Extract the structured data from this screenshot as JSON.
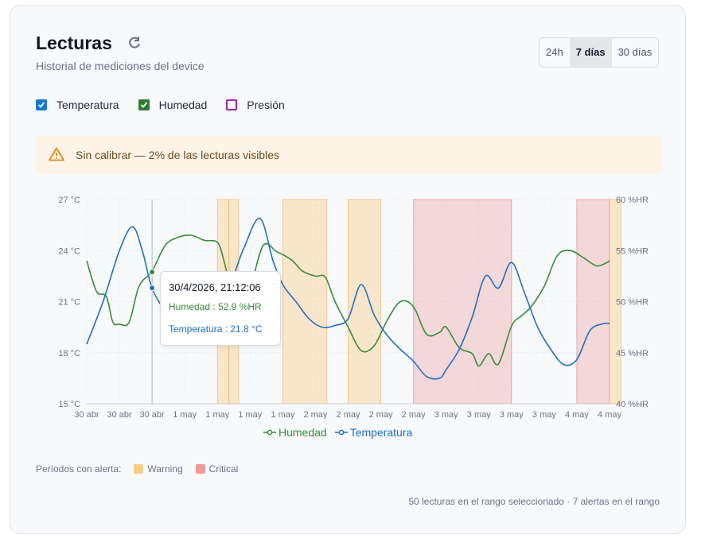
{
  "header": {
    "title": "Lecturas",
    "subtitle": "Historial de mediciones del device",
    "range_options": [
      "24h",
      "7 días",
      "30 días"
    ],
    "range_selected": "7 días"
  },
  "toggles": [
    {
      "label": "Temperatura",
      "checked": true,
      "color": "#1976d2"
    },
    {
      "label": "Humedad",
      "checked": true,
      "color": "#2e7d32"
    },
    {
      "label": "Presión",
      "checked": false,
      "color": "#9c27b0"
    }
  ],
  "banner": {
    "icon": "warning-triangle-icon",
    "text": "Sin calibrar — 2% de las lecturas visibles"
  },
  "colors": {
    "temperature": "#1e6fc4",
    "humidity": "#3a8a3a",
    "warning": "#f7cd86",
    "critical": "#ef9a9a"
  },
  "chart_data": {
    "type": "line",
    "x_ticks": [
      "30 abr",
      "30 abr",
      "30 abr",
      "1 may",
      "1 may",
      "1 may",
      "1 may",
      "2 may",
      "2 may",
      "2 may",
      "2 may",
      "3 may",
      "3 may",
      "3 may",
      "3 may",
      "4 may",
      "4 may"
    ],
    "y_left": {
      "label_unit": "°C",
      "ticks": [
        "27 °C",
        "24 °C",
        "21 °C",
        "18 °C",
        "15 °C"
      ],
      "range": [
        15,
        27
      ]
    },
    "y_right": {
      "label_unit": "%HR",
      "ticks": [
        "60 %HR",
        "55 %HR",
        "50 %HR",
        "45 %HR",
        "40 %HR"
      ],
      "range": [
        40,
        60
      ]
    },
    "series": [
      {
        "name": "Humedad",
        "axis": "right",
        "x": [
          0,
          0.3,
          0.6,
          0.8,
          1,
          1.3,
          1.6,
          2,
          2.4,
          2.8,
          3.2,
          3.6,
          4,
          4.2,
          4.4,
          4.6,
          4.8,
          5,
          5.4,
          5.8,
          6,
          6.3,
          6.6,
          7,
          7.3,
          7.6,
          8,
          8.4,
          8.8,
          9.2,
          9.6,
          10,
          10.4,
          10.8,
          11,
          11.4,
          11.8,
          12,
          12.3,
          12.6,
          13,
          13.3,
          13.6,
          14,
          14.4,
          14.8,
          15.2,
          15.6,
          15.9,
          16
        ],
        "values": [
          54,
          51,
          50.5,
          48,
          47.8,
          48,
          51.5,
          53,
          55.5,
          56.3,
          56.5,
          56,
          55.8,
          54,
          51.5,
          51.5,
          51,
          51.3,
          55.5,
          54.9,
          54.6,
          54,
          53,
          52.5,
          52.4,
          50,
          47.5,
          45.2,
          45.7,
          48.2,
          50,
          49.5,
          46.8,
          47,
          47.5,
          45.5,
          44.9,
          43.7,
          44.9,
          43.9,
          47.6,
          48.6,
          49.5,
          51.5,
          54.5,
          55,
          54.3,
          53.5,
          53.8,
          54
        ]
      },
      {
        "name": "Temperatura",
        "axis": "left",
        "x": [
          0,
          0.5,
          1,
          1.4,
          1.7,
          2,
          2.4,
          2.8,
          3.2,
          3.6,
          4,
          4.4,
          4.8,
          5.3,
          5.7,
          6,
          6.4,
          6.8,
          7.2,
          7.6,
          8,
          8.4,
          8.8,
          9.2,
          9.6,
          10,
          10.4,
          10.8,
          11,
          11.4,
          11.8,
          12.2,
          12.6,
          13,
          13.4,
          13.8,
          14.2,
          14.6,
          15,
          15.4,
          15.8,
          16
        ],
        "values": [
          18.5,
          21,
          24,
          25.4,
          24,
          21.8,
          20.5,
          20.1,
          20.3,
          20.4,
          21.2,
          22.1,
          24.1,
          25.9,
          23.4,
          22,
          21,
          20,
          19.5,
          19.6,
          20,
          22,
          20.2,
          19,
          18.2,
          17.5,
          16.6,
          16.5,
          17,
          18.2,
          20.1,
          22.5,
          21.8,
          23.3,
          21.5,
          19.5,
          18.2,
          17.3,
          17.6,
          19.3,
          19.7,
          19.7
        ]
      }
    ],
    "alert_periods": [
      {
        "level": "Warning",
        "from": 4,
        "to": 4.35
      },
      {
        "level": "Warning",
        "from": 4.35,
        "to": 4.65
      },
      {
        "level": "Warning",
        "from": 6,
        "to": 7.35
      },
      {
        "level": "Warning",
        "from": 8,
        "to": 9
      },
      {
        "level": "Critical",
        "from": 10,
        "to": 13
      },
      {
        "level": "Critical",
        "from": 15,
        "to": 16
      },
      {
        "level": "Warning",
        "from": 16,
        "to": 16.35
      }
    ],
    "grid": true,
    "legend_position": "bottom-center"
  },
  "tooltip": {
    "date": "30/4/2026, 21:12:06",
    "line1": "Humedad : 52.9 %HR",
    "line2": "Temperatura : 21.8 °C",
    "x": 2,
    "humidity_value": 52.9,
    "temperature_value": 21.8
  },
  "legend": [
    {
      "label": "Humedad",
      "color": "#3a8a3a"
    },
    {
      "label": "Temperatura",
      "color": "#1e6fc4"
    }
  ],
  "alerts_legend": {
    "label": "Períodos con alerta:",
    "items": [
      {
        "label": "Warning",
        "color": "#f7cd86"
      },
      {
        "label": "Critical",
        "color": "#ef9a9a"
      }
    ]
  },
  "footer": {
    "summary": "50 lecturas en el rango seleccionado · 7 alertas en el rango"
  }
}
